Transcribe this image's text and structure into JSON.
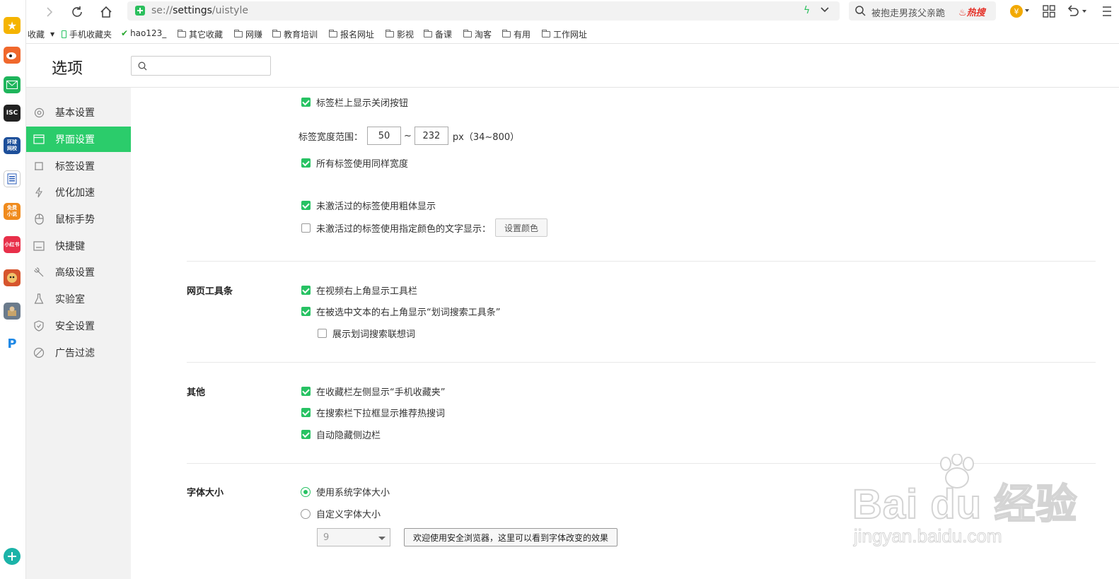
{
  "browser": {
    "url_scheme": "se://",
    "url_host": "settings",
    "url_path": "/uistyle",
    "search_placeholder": "被抱走男孩父亲跪",
    "hot_label": "热搜"
  },
  "bookmarks": [
    {
      "label": "收藏"
    },
    {
      "label": "手机收藏夹"
    },
    {
      "label": "hao123_"
    },
    {
      "label": "其它收藏"
    },
    {
      "label": "网赚"
    },
    {
      "label": "教育培训"
    },
    {
      "label": "报名网址"
    },
    {
      "label": "影视"
    },
    {
      "label": "备课"
    },
    {
      "label": "淘客"
    },
    {
      "label": "有用"
    },
    {
      "label": "工作网址"
    }
  ],
  "page": {
    "title": "选项",
    "search_placeholder": ""
  },
  "sidebar": {
    "items": [
      {
        "label": "基本设置",
        "icon": "gear-icon"
      },
      {
        "label": "界面设置",
        "icon": "window-icon"
      },
      {
        "label": "标签设置",
        "icon": "tab-icon"
      },
      {
        "label": "优化加速",
        "icon": "lightning-icon"
      },
      {
        "label": "鼠标手势",
        "icon": "mouse-icon"
      },
      {
        "label": "快捷键",
        "icon": "keyboard-icon"
      },
      {
        "label": "高级设置",
        "icon": "wrench-icon"
      },
      {
        "label": "实验室",
        "icon": "flask-icon"
      },
      {
        "label": "安全设置",
        "icon": "shield-icon"
      },
      {
        "label": "广告过滤",
        "icon": "block-icon"
      }
    ]
  },
  "tabs_section": {
    "show_close_button": "标签栏上显示关闭按钮",
    "width_range_label": "标签宽度范围：",
    "width_min": "50",
    "width_sep": "~",
    "width_max": "232",
    "width_unit": "px（34~800）",
    "same_width": "所有标签使用同样宽度",
    "bold_inactive": "未激活过的标签使用粗体显示",
    "color_inactive": "未激活过的标签使用指定颜色的文字显示：",
    "set_color_button": "设置颜色"
  },
  "toolbar_section": {
    "heading": "网页工具条",
    "video_toolbar": "在视频右上角显示工具栏",
    "selection_toolbar": "在被选中文本的右上角显示“划词搜索工具条”",
    "selection_suggest": "展示划词搜索联想词"
  },
  "other_section": {
    "heading": "其他",
    "mobile_fav": "在收藏栏左侧显示“手机收藏夹”",
    "hot_words": "在搜索栏下拉框显示推荐热搜词",
    "auto_hide_sidebar": "自动隐藏侧边栏"
  },
  "font_section": {
    "heading": "字体大小",
    "system_font": "使用系统字体大小",
    "custom_font": "自定义字体大小",
    "font_size_value": "9",
    "preview_text": "欢迎使用安全浏览器，这里可以看到字体改变的效果"
  },
  "watermark": {
    "brand": "Bai du 经验",
    "url": "jingyan.baidu.com"
  },
  "colors": {
    "accent": "#2bcc6b",
    "checkbox": "#27c263"
  }
}
